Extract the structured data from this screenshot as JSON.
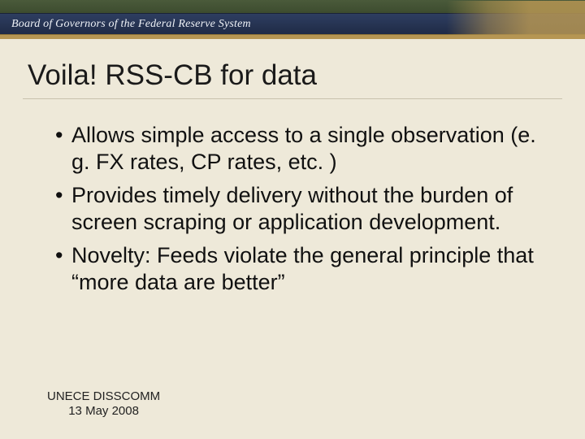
{
  "banner": {
    "org_title": "Board of Governors of the Federal Reserve System"
  },
  "slide": {
    "title": "Voila!  RSS-CB for data",
    "bullets": [
      "Allows simple access to a single observation (e. g. FX rates, CP rates, etc. )",
      "Provides timely delivery without the burden of screen scraping or application development.",
      "Novelty:  Feeds violate the general principle that “more data are better”"
    ]
  },
  "footer": {
    "line1": "UNECE DISSCOMM",
    "line2": "13 May 2008"
  }
}
